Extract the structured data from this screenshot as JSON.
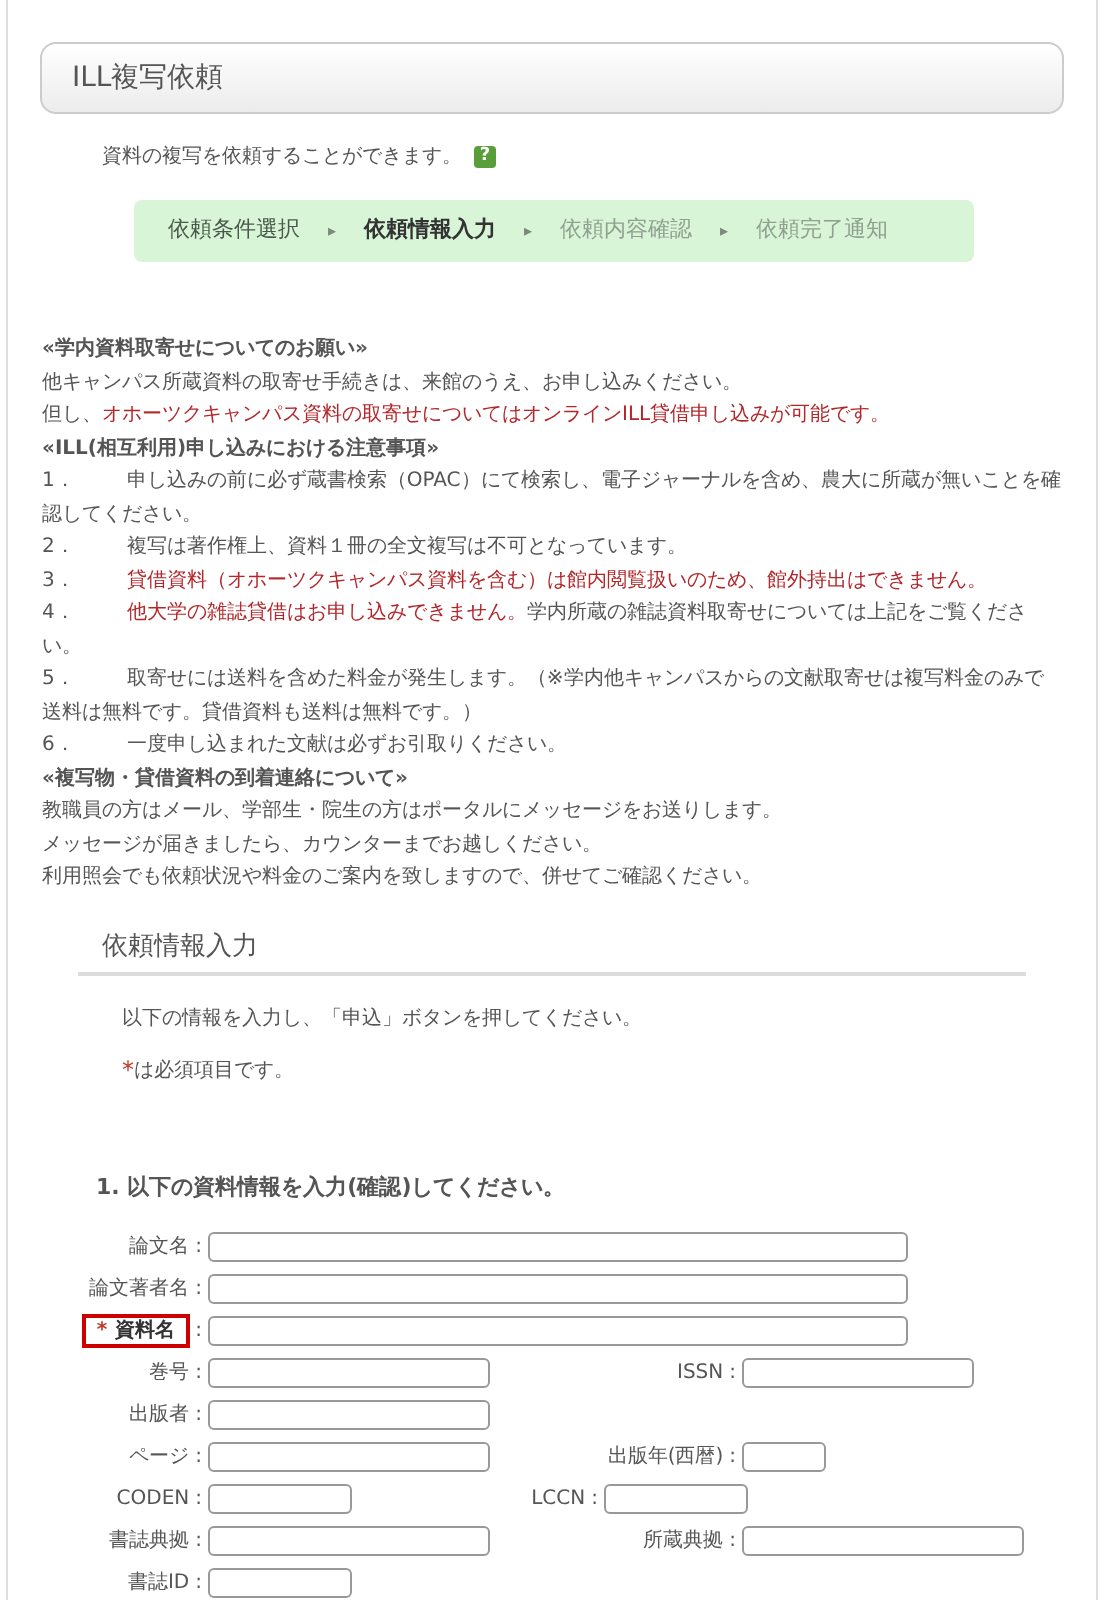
{
  "header": {
    "title": "ILL複写依頼"
  },
  "intro": {
    "text": "資料の複写を依頼することができます。",
    "help_icon": "?"
  },
  "steps": [
    {
      "label": "依頼条件選択",
      "selected": false,
      "disabled": false
    },
    {
      "label": "依頼情報入力",
      "selected": true,
      "disabled": false
    },
    {
      "label": "依頼内容確認",
      "selected": false,
      "disabled": true
    },
    {
      "label": "依頼完了通知",
      "selected": false,
      "disabled": true
    }
  ],
  "step_separator": "▸",
  "notices": [
    {
      "kind": "heading",
      "segments": [
        {
          "text": "«学内資料取寄せについてのお願い»",
          "emphasis": false
        }
      ]
    },
    {
      "kind": "text",
      "segments": [
        {
          "text": "他キャンパス所蔵資料の取寄せ手続きは、来館のうえ、お申し込みください。",
          "emphasis": false
        }
      ]
    },
    {
      "kind": "text",
      "segments": [
        {
          "text": "但し、",
          "emphasis": false
        },
        {
          "text": "オホーツクキャンパス資料の取寄せについてはオンラインILL貸借申し込みが可能です。",
          "emphasis": true
        }
      ]
    },
    {
      "kind": "heading",
      "segments": [
        {
          "text": "«ILL(相互利用)申し込みにおける注意事項»",
          "emphasis": false
        }
      ]
    },
    {
      "kind": "numbered",
      "number": "1．",
      "segments": [
        {
          "text": "申し込みの前に必ず蔵書検索（OPAC）にて検索し、電子ジャーナルを含め、農大に所蔵が無いことを確認してください。",
          "emphasis": false
        }
      ]
    },
    {
      "kind": "numbered",
      "number": "2．",
      "segments": [
        {
          "text": "複写は著作権上、資料１冊の全文複写は不可となっています。",
          "emphasis": false
        }
      ]
    },
    {
      "kind": "numbered",
      "number": "3．",
      "segments": [
        {
          "text": "貸借資料（オホーツクキャンパス資料を含む）は館内閲覧扱いのため、館外持出はできません。",
          "emphasis": true
        }
      ]
    },
    {
      "kind": "numbered",
      "number": "4．",
      "segments": [
        {
          "text": "他大学の雑誌貸借はお申し込みできません。",
          "emphasis": true
        },
        {
          "text": "学内所蔵の雑誌資料取寄せについては上記をご覧ください。",
          "emphasis": false
        }
      ]
    },
    {
      "kind": "numbered",
      "number": "5．",
      "segments": [
        {
          "text": "取寄せには送料を含めた料金が発生します。（※学内他キャンパスからの文献取寄せは複写料金のみで送料は無料です。貸借資料も送料は無料です。）",
          "emphasis": false
        }
      ]
    },
    {
      "kind": "numbered",
      "number": "6．",
      "segments": [
        {
          "text": "一度申し込まれた文献は必ずお引取りください。",
          "emphasis": false
        }
      ]
    },
    {
      "kind": "heading",
      "segments": [
        {
          "text": "«複写物・貸借資料の到着連絡について»",
          "emphasis": false
        }
      ]
    },
    {
      "kind": "text",
      "segments": [
        {
          "text": "教職員の方はメール、学部生・院生の方はポータルにメッセージをお送りします。",
          "emphasis": false
        }
      ]
    },
    {
      "kind": "text",
      "segments": [
        {
          "text": "メッセージが届きましたら、カウンターまでお越しください。",
          "emphasis": false
        }
      ]
    },
    {
      "kind": "text",
      "segments": [
        {
          "text": "利用照会でも依頼状況や料金のご案内を致しますので、併せてご確認ください。",
          "emphasis": false
        }
      ]
    }
  ],
  "section": {
    "title": "依頼情報入力",
    "instruction": "以下の情報を入力し、「申込」ボタンを押してください。",
    "required_mark": "*",
    "required_note": "は必須項目です。"
  },
  "form": {
    "title": "1. 以下の資料情報を入力(確認)してください。",
    "separator": ":",
    "rows": [
      {
        "fields": [
          {
            "label": "論文名",
            "kind": "wide",
            "required": false,
            "highlighted": false
          }
        ]
      },
      {
        "fields": [
          {
            "label": "論文著者名",
            "kind": "wide",
            "required": false,
            "highlighted": false
          }
        ]
      },
      {
        "fields": [
          {
            "label": "資料名",
            "kind": "wide",
            "required": true,
            "highlighted": true
          }
        ]
      },
      {
        "fields": [
          {
            "label": "巻号",
            "kind": "medium",
            "required": false,
            "highlighted": false
          },
          {
            "label": "ISSN",
            "kind": "medium_small",
            "required": false,
            "highlighted": false
          }
        ]
      },
      {
        "fields": [
          {
            "label": "出版者",
            "kind": "medium",
            "required": false,
            "highlighted": false
          }
        ]
      },
      {
        "fields": [
          {
            "label": "ページ",
            "kind": "medium",
            "required": false,
            "highlighted": false
          },
          {
            "label": "出版年(西暦)",
            "kind": "tiny",
            "required": false,
            "highlighted": false
          }
        ]
      },
      {
        "fields": [
          {
            "label": "CODEN",
            "kind": "short",
            "required": false,
            "highlighted": false
          },
          {
            "label": "LCCN",
            "kind": "short",
            "required": false,
            "highlighted": false
          }
        ]
      },
      {
        "fields": [
          {
            "label": "書誌典拠",
            "kind": "medium",
            "required": false,
            "highlighted": false
          },
          {
            "label": "所蔵典拠",
            "kind": "medium",
            "required": false,
            "highlighted": false
          }
        ]
      },
      {
        "fields": [
          {
            "label": "書誌ID",
            "kind": "short",
            "required": false,
            "highlighted": false
          }
        ]
      }
    ]
  }
}
